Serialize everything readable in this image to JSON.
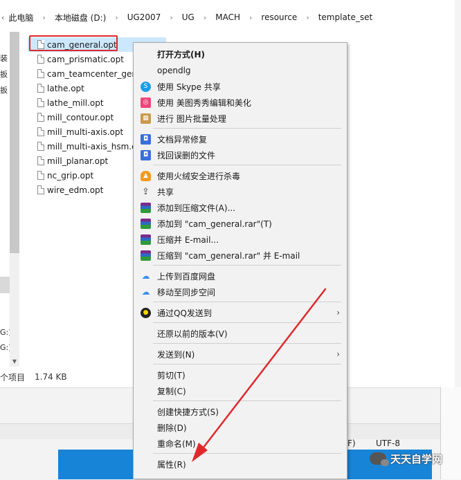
{
  "breadcrumb": {
    "leading_glyph": "‹",
    "items": [
      "此电脑",
      "本地磁盘 (D:)",
      "UG2007",
      "UG",
      "MACH",
      "resource",
      "template_set"
    ],
    "separator": "›"
  },
  "nav_pane": {
    "fragments": [
      "装",
      "扳",
      "扳",
      "G:)",
      "G:)"
    ]
  },
  "files": [
    {
      "name": "cam_general.opt",
      "selected": true
    },
    {
      "name": "cam_prismatic.opt",
      "selected": false
    },
    {
      "name": "cam_teamcenter_gen",
      "selected": false
    },
    {
      "name": "lathe.opt",
      "selected": false
    },
    {
      "name": "lathe_mill.opt",
      "selected": false
    },
    {
      "name": "mill_contour.opt",
      "selected": false
    },
    {
      "name": "mill_multi-axis.opt",
      "selected": false
    },
    {
      "name": "mill_multi-axis_hsm.op",
      "selected": false
    },
    {
      "name": "mill_planar.opt",
      "selected": false
    },
    {
      "name": "nc_grip.opt",
      "selected": false
    },
    {
      "name": "wire_edm.opt",
      "selected": false
    }
  ],
  "status": {
    "count": "个项目",
    "size": "1.74 KB"
  },
  "background_window": {
    "line_ending": "F)",
    "encoding": "UTF-8"
  },
  "context_menu": {
    "items": [
      {
        "label": "打开方式(H)",
        "bold": true,
        "icon": "none"
      },
      {
        "label": "opendlg",
        "icon": "none"
      },
      {
        "label": "使用 Skype 共享",
        "icon": "skype-icon",
        "color": "#1c9ee6"
      },
      {
        "label": "使用 美图秀秀编辑和美化",
        "icon": "meitu-icon",
        "color": "#f0457a"
      },
      {
        "label": "进行 图片批量处理",
        "icon": "image-batch-icon",
        "color": "#c99a4a"
      },
      {
        "label": "文档异常修复",
        "icon": "doc-repair-icon",
        "color": "#3a6fd8"
      },
      {
        "label": "找回误删的文件",
        "icon": "file-recover-icon",
        "color": "#3a6fd8"
      },
      {
        "label": "使用火绒安全进行杀毒",
        "icon": "huorong-icon",
        "color": "#f29a1f"
      },
      {
        "label": "共享",
        "icon": "share-icon"
      },
      {
        "label": "添加到压缩文件(A)...",
        "icon": "winrar-icon"
      },
      {
        "label": "添加到 \"cam_general.rar\"(T)",
        "icon": "winrar-icon"
      },
      {
        "label": "压缩并 E-mail...",
        "icon": "winrar-icon"
      },
      {
        "label": "压缩到 \"cam_general.rar\" 并 E-mail",
        "icon": "winrar-icon"
      },
      {
        "label": "上传到百度网盘",
        "icon": "baidu-cloud-icon",
        "color": "#3b8ff0"
      },
      {
        "label": "移动至同步空间",
        "icon": "baidu-cloud-icon",
        "color": "#3b8ff0"
      },
      {
        "label": "通过QQ发送到",
        "icon": "qq-icon",
        "submenu": true
      },
      {
        "label": "还原以前的版本(V)",
        "icon": "none"
      },
      {
        "label": "发送到(N)",
        "icon": "none",
        "submenu": true
      },
      {
        "label": "剪切(T)",
        "icon": "none"
      },
      {
        "label": "复制(C)",
        "icon": "none"
      },
      {
        "label": "创建快捷方式(S)",
        "icon": "none"
      },
      {
        "label": "删除(D)",
        "icon": "none"
      },
      {
        "label": "重命名(M)",
        "icon": "none"
      },
      {
        "label": "属性(R)",
        "icon": "none"
      }
    ],
    "submenu_glyph": "›"
  },
  "annotation": {
    "arrow_color": "#e0282c",
    "highlight_color": "#e0282c"
  },
  "watermark": {
    "text": "天天自学网"
  }
}
